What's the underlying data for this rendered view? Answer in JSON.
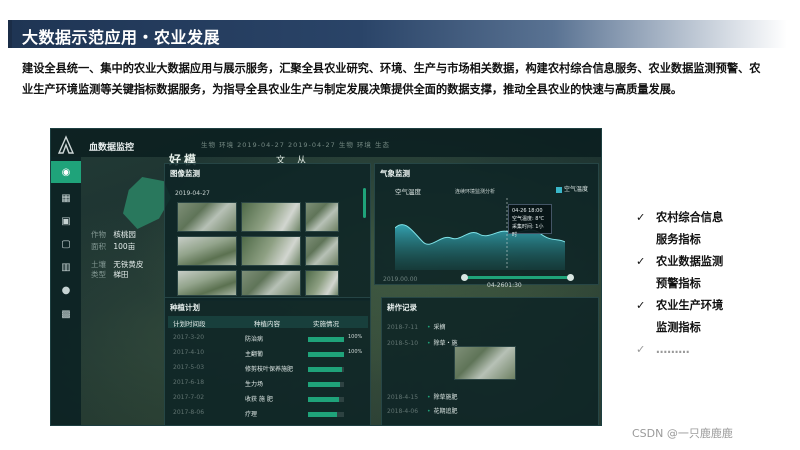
{
  "title": "大数据示范应用・农业发展",
  "description": "建设全县统一、集中的农业大数据应用与展示服务，汇聚全县农业研究、环境、生产与市场相关数据，构建农村综合信息服务、农业数据监测预警、农业生产环境监测等关键指标数据服务，为指导全县农业生产与制定发展决策提供全面的数据支撑，推动全县农业的快速与高质量发展。",
  "dashboard": {
    "title": "血数据监控",
    "top_chars_big": "好模",
    "top_chars_small": "文从",
    "tags": "生物 环境 2019-04-27   2019-04-27   生物 环境 生态",
    "nav_icons": [
      "home-icon",
      "building-icon",
      "image-icon",
      "frame-icon",
      "chart-icon",
      "settings-icon",
      "grid-icon"
    ],
    "info": [
      {
        "label": "作物",
        "value": "核桃园"
      },
      {
        "label": "面积",
        "value": "100亩"
      },
      {
        "label": "土壤",
        "value": "无铁黄皮"
      },
      {
        "label": "类型",
        "value": "梯田"
      }
    ],
    "image_panel": {
      "title": "图像监测",
      "date": "2019-04-27"
    },
    "weather_panel": {
      "title": "气象监测",
      "subtitle": "空气温度",
      "chart_title": "连续环境监测分析",
      "legend": "空气温度",
      "legend_color": "#3ab7c9",
      "tooltip": [
        "04-26 18:00",
        "空气温度: 8℃",
        "采集时间: 1小时"
      ],
      "slider_label": "04-2601:30",
      "left_label": "2019.00.00"
    },
    "plan_panel": {
      "title": "种植计划",
      "headers": [
        "计划时间段",
        "种植内容",
        "实施情况"
      ],
      "rows": [
        {
          "date": "2017-3-20",
          "crop": "防治病",
          "pct": "100%",
          "progress": 1.0
        },
        {
          "date": "2017-4-10",
          "crop": "主翻葡",
          "pct": "100%",
          "progress": 1.0
        },
        {
          "date": "2017-5-03",
          "crop": "修剪枝叶保养施肥",
          "pct": "",
          "progress": 0.95
        },
        {
          "date": "2017-6-18",
          "crop": "生力场",
          "pct": "",
          "progress": 0.9
        },
        {
          "date": "2017-7-02",
          "crop": "收获 施 肥",
          "pct": "",
          "progress": 0.85
        },
        {
          "date": "2017-8-06",
          "crop": "疗理",
          "pct": "",
          "progress": 0.8
        }
      ]
    },
    "record_panel": {
      "title": "耕作记录",
      "items": [
        {
          "date": "2018-7-11",
          "text": "采摘"
        },
        {
          "date": "2018-5-10",
          "text": "除草・施"
        },
        {
          "date": "2018-4-15",
          "text": "除草施肥"
        },
        {
          "date": "2018-4-06",
          "text": "花期追肥"
        }
      ]
    }
  },
  "bullets": [
    {
      "mark": "✓",
      "line1": "农村综合信息",
      "line2": "服务指标"
    },
    {
      "mark": "✓",
      "line1": "农业数据监测",
      "line2": "预警指标"
    },
    {
      "mark": "✓",
      "line1": "农业生产环境",
      "line2": "监测指标"
    },
    {
      "mark": "✓",
      "line1": "………",
      "line2": ""
    }
  ],
  "watermark": "CSDN @一只鹿鹿鹿"
}
